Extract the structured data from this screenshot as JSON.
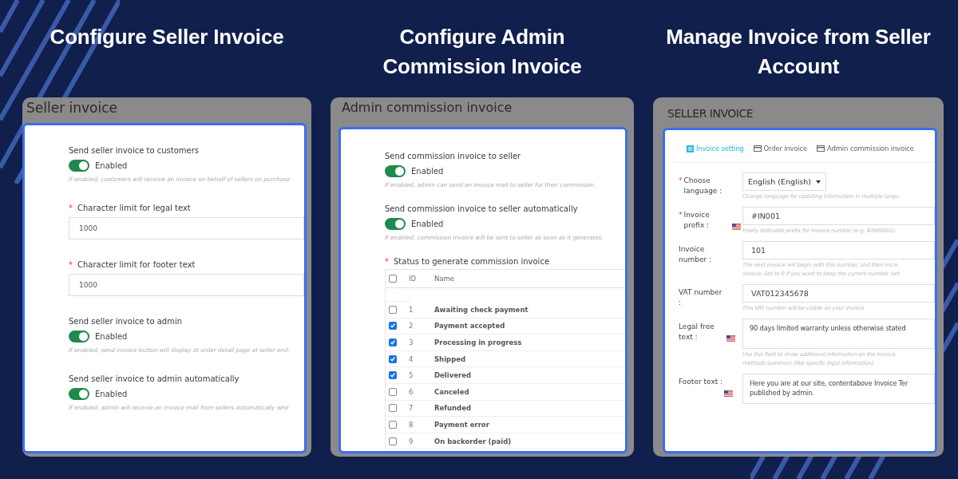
{
  "columns": [
    {
      "heading": "Configure Seller Invoice",
      "panel_title": "Seller invoice",
      "kind": "settings",
      "fields": [
        {
          "kind": "toggle",
          "label": "Send seller invoice to customers",
          "on": true,
          "state_label": "Enabled",
          "hint": "If enabled, customers will receive an invoice on behalf of sellers on purchase"
        },
        {
          "kind": "input",
          "label": "Character limit for legal text",
          "required_mark": "*",
          "value": "1000"
        },
        {
          "kind": "input",
          "label": "Character limit for footer text",
          "required_mark": "*",
          "value": "1000"
        },
        {
          "kind": "toggle",
          "label": "Send seller invoice to admin",
          "on": true,
          "state_label": "Enabled",
          "hint": "If enabled, send invoice button will display at order detail page at seller end."
        },
        {
          "kind": "toggle",
          "label": "Send seller invoice to admin automatically",
          "on": true,
          "state_label": "Enabled",
          "hint": "If enabled, admin will receive an invoice mail from sellers automatically whe"
        }
      ]
    },
    {
      "heading": "Configure Admin Commission Invoice",
      "panel_title": "Admin commission invoice",
      "kind": "settings",
      "fields": [
        {
          "kind": "toggle",
          "label": "Send commission invoice to seller",
          "on": true,
          "state_label": "Enabled",
          "hint": "If enabled, admin can send an invoice mail to seller for their commission."
        },
        {
          "kind": "toggle",
          "label": "Send commission invoice to seller automatically",
          "on": true,
          "state_label": "Enabled",
          "hint": "If enabled, commission invoice will be sent to seller as soon as it generates."
        },
        {
          "kind": "table",
          "label": "Status to generate commission invoice",
          "required_mark": "*",
          "header_checked": false,
          "columns": [
            "ID",
            "Name"
          ],
          "rows": [
            {
              "id": "1",
              "name": "Awaiting check payment",
              "checked": false
            },
            {
              "id": "2",
              "name": "Payment accepted",
              "checked": true
            },
            {
              "id": "3",
              "name": "Processing in progress",
              "checked": true
            },
            {
              "id": "4",
              "name": "Shipped",
              "checked": true
            },
            {
              "id": "5",
              "name": "Delivered",
              "checked": true
            },
            {
              "id": "6",
              "name": "Canceled",
              "checked": false
            },
            {
              "id": "7",
              "name": "Refunded",
              "checked": false
            },
            {
              "id": "8",
              "name": "Payment error",
              "checked": false
            },
            {
              "id": "9",
              "name": "On backorder (paid)",
              "checked": false
            }
          ]
        }
      ]
    },
    {
      "heading": "Manage Invoice from Seller Account",
      "panel_title": "SELLER INVOICE",
      "kind": "form",
      "tabs": [
        {
          "label": "Invoice setting",
          "selected": true
        },
        {
          "label": "Order invoice",
          "selected": false
        },
        {
          "label": "Admin commission invoice",
          "selected": false
        }
      ],
      "rows": [
        {
          "kind": "select",
          "label": "Choose language :",
          "required_mark": "*",
          "flag": false,
          "value": "English (English)",
          "hint": [
            "Change language for updating information in multiple langu"
          ]
        },
        {
          "kind": "input",
          "label": "Invoice prefix :",
          "required_mark": "*",
          "flag": true,
          "value": "#IN001",
          "hint": [
            "Freely definable prefix for invoice number (e.g. #IN00001)."
          ]
        },
        {
          "kind": "input",
          "label": "Invoice number :",
          "flag": false,
          "value": "101",
          "hint": [
            "The next invoice will begin with this number, and then incre",
            "invoice. Set to 0 if you want to keep the current number (wh"
          ]
        },
        {
          "kind": "input",
          "label": "VAT number :",
          "flag": false,
          "value": "VAT012345678",
          "hint": [
            "This VAT number will be visible on your invoice"
          ]
        },
        {
          "kind": "textarea",
          "label": "Legal free text :",
          "flag": true,
          "value": "90 days limited warranty unless otherwise stated",
          "hint": [
            "Use this field to show additional information on the invoice,",
            "methods summary (like specific legal information)."
          ]
        },
        {
          "kind": "textarea",
          "label": "Footer text :",
          "flag": true,
          "value": "Here you are at our site, contentabove Invoice Ter\npublished by admin."
        }
      ]
    }
  ]
}
